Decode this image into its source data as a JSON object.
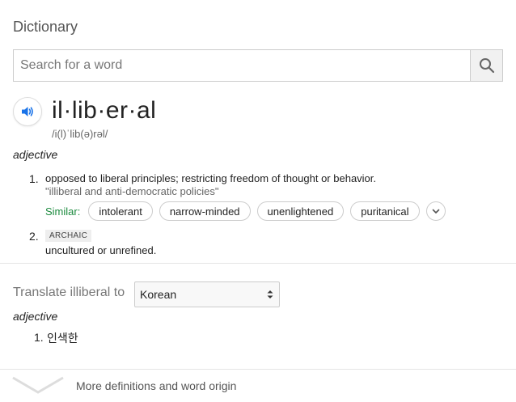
{
  "header": {
    "title": "Dictionary"
  },
  "search": {
    "placeholder": "Search for a word",
    "value": ""
  },
  "entry": {
    "headword": "il·lib·er·al",
    "phonetic": "/i(l)ˈlib(ə)rəl/",
    "part_of_speech": "adjective",
    "definitions": [
      {
        "number": "1.",
        "text": "opposed to liberal principles; restricting freedom of thought or behavior.",
        "example": "\"illiberal and anti-democratic policies\"",
        "similar_label": "Similar:",
        "similar": [
          "intolerant",
          "narrow-minded",
          "unenlightened",
          "puritanical"
        ]
      },
      {
        "number": "2.",
        "tag": "ARCHAIC",
        "text": "uncultured or unrefined."
      }
    ]
  },
  "translate": {
    "label": "Translate illiberal to",
    "language": "Korean",
    "part_of_speech": "adjective",
    "items": [
      {
        "number": "1.",
        "text": "인색한"
      }
    ]
  },
  "footer": {
    "more_label": "More definitions and word origin"
  },
  "colors": {
    "accent": "#1a73e8",
    "similar": "#1b8a3e"
  }
}
